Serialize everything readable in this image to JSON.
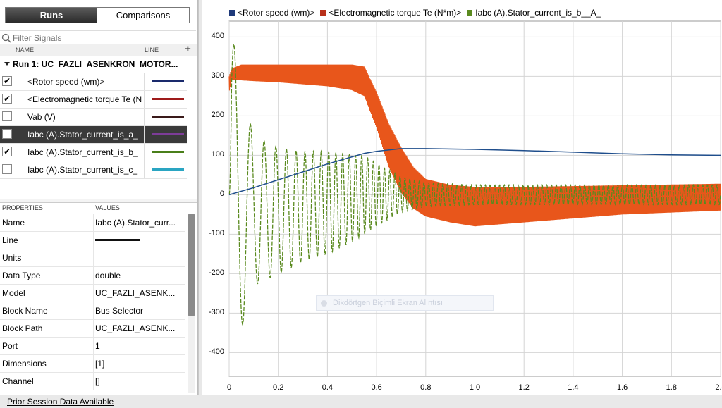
{
  "tabs": {
    "runs": "Runs",
    "comparisons": "Comparisons"
  },
  "filter": {
    "placeholder": "Filter Signals"
  },
  "signal_table": {
    "col_name": "NAME",
    "col_line": "LINE",
    "add_symbol": "+",
    "run_title": "Run 1: UC_FAZLI_ASENKRON_MOTOR...",
    "signals": [
      {
        "label": "<Rotor speed (wm)>",
        "checked": true,
        "color": "#1a2a6c"
      },
      {
        "label": "<Electromagnetic torque Te (N",
        "checked": true,
        "color": "#9e1b1b"
      },
      {
        "label": "Vab (V)",
        "checked": false,
        "color": "#3a1a1a"
      },
      {
        "label": "Iabc (A).Stator_current_is_a_",
        "checked": false,
        "color": "#7d3c98",
        "selected": true
      },
      {
        "label": "Iabc (A).Stator_current_is_b_",
        "checked": true,
        "color": "#4a7f1a"
      },
      {
        "label": "Iabc (A).Stator_current_is_c_",
        "checked": false,
        "color": "#2aa5c2"
      }
    ]
  },
  "properties": {
    "col_properties": "PROPERTIES",
    "col_values": "VALUES",
    "rows": [
      {
        "key": "Name",
        "value": "Iabc (A).Stator_curr..."
      },
      {
        "key": "Line",
        "value": ""
      },
      {
        "key": "Units",
        "value": ""
      },
      {
        "key": "Data Type",
        "value": "double"
      },
      {
        "key": "Model",
        "value": "UC_FAZLI_ASENK..."
      },
      {
        "key": "Block Name",
        "value": "Bus Selector"
      },
      {
        "key": "Block Path",
        "value": "UC_FAZLI_ASENK..."
      },
      {
        "key": "Port",
        "value": "1"
      },
      {
        "key": "Dimensions",
        "value": "[1]"
      },
      {
        "key": "Channel",
        "value": "[]"
      }
    ]
  },
  "status": {
    "text": "Prior Session Data Available"
  },
  "overlay": {
    "text": "Dikdörtgen Biçimli Ekran Alıntısı"
  },
  "chart_data": {
    "type": "line",
    "xlim": [
      0,
      2.0
    ],
    "ylim": [
      -460,
      440
    ],
    "xticks": [
      "0",
      "0.2",
      "0.4",
      "0.6",
      "0.8",
      "1.0",
      "1.2",
      "1.4",
      "1.6",
      "1.8",
      "2.0"
    ],
    "yticks": [
      "400",
      "300",
      "200",
      "100",
      "0",
      "-100",
      "-200",
      "-300",
      "-400"
    ],
    "grid": true,
    "legend_position": "top",
    "series": [
      {
        "name": "<Rotor speed (wm)>",
        "color": "#1f4e8c",
        "x": [
          0,
          0.1,
          0.2,
          0.3,
          0.4,
          0.5,
          0.55,
          0.6,
          0.7,
          0.8,
          1.0,
          1.2,
          1.4,
          1.6,
          1.8,
          2.0
        ],
        "y": [
          0,
          18,
          38,
          58,
          78,
          96,
          105,
          110,
          117,
          117,
          115,
          112,
          108,
          104,
          101,
          100
        ]
      },
      {
        "name": "<Electromagnetic torque Te (N*m)>",
        "color": "#e8561b",
        "envelope_x": [
          0,
          0.01,
          0.05,
          0.1,
          0.2,
          0.3,
          0.4,
          0.5,
          0.55,
          0.6,
          0.65,
          0.7,
          0.75,
          0.8,
          0.9,
          1.0,
          1.1,
          1.2,
          1.4,
          1.6,
          1.8,
          2.0
        ],
        "envelope_upper": [
          300,
          320,
          330,
          330,
          330,
          330,
          330,
          330,
          325,
          260,
          180,
          120,
          70,
          40,
          25,
          20,
          20,
          20,
          22,
          24,
          26,
          28
        ],
        "envelope_lower": [
          260,
          290,
          290,
          288,
          285,
          280,
          275,
          265,
          250,
          170,
          70,
          5,
          -35,
          -55,
          -70,
          -80,
          -75,
          -70,
          -60,
          -50,
          -45,
          -40
        ]
      },
      {
        "name": "Iabc (A).Stator_current_is_b__A_",
        "color": "#5a8a1f",
        "x": [
          0,
          0.01,
          0.03,
          0.05,
          0.1,
          0.2,
          0.3,
          0.4,
          0.5,
          0.55,
          0.6,
          0.7,
          0.8,
          1.0,
          1.2,
          1.5,
          2.0
        ],
        "amplitude": [
          0,
          430,
          380,
          300,
          190,
          160,
          140,
          130,
          110,
          100,
          80,
          45,
          30,
          25,
          25,
          25,
          25
        ],
        "offset": [
          0,
          -20,
          -30,
          -40,
          -40,
          -40,
          -30,
          -20,
          -10,
          0,
          0,
          0,
          0,
          0,
          0,
          0,
          0
        ]
      }
    ]
  }
}
